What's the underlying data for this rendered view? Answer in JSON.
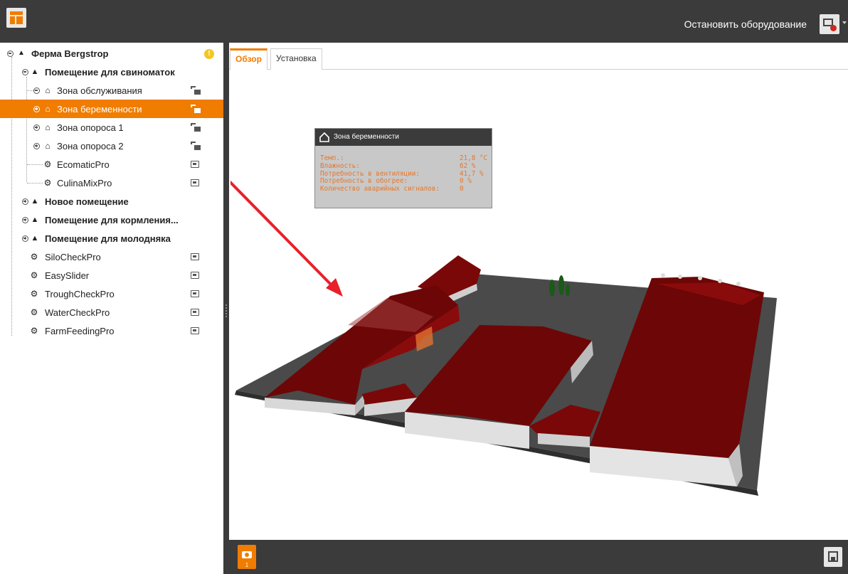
{
  "header": {
    "stop_equipment_label": "Остановить оборудование",
    "logo_icon": "app-logo-icon",
    "equipment_icon": "equipment-status-icon"
  },
  "tree": {
    "farm": {
      "label": "Ферма Bergstrop",
      "alert": "!"
    },
    "rooms": [
      {
        "label": "Помещение для свиноматок"
      },
      {
        "label": "Новое помещение"
      },
      {
        "label": "Помещение для кормления..."
      },
      {
        "label": "Помещение для молодняка"
      }
    ],
    "zones": [
      {
        "label": "Зона обслуживания"
      },
      {
        "label": "Зона беременности"
      },
      {
        "label": "Зона опороса 1"
      },
      {
        "label": "Зона опороса 2"
      }
    ],
    "room_devices": [
      {
        "label": "EcomaticPro"
      },
      {
        "label": "CulinaMixPro"
      }
    ],
    "farm_devices": [
      {
        "label": "SiloCheckPro"
      },
      {
        "label": "EasySlider"
      },
      {
        "label": "TroughCheckPro"
      },
      {
        "label": "WaterCheckPro"
      },
      {
        "label": "FarmFeedingPro"
      }
    ]
  },
  "tabs": [
    {
      "label": "Обзор",
      "active": true
    },
    {
      "label": "Установка",
      "active": false
    }
  ],
  "info_panel": {
    "title": "Зона беременности",
    "rows": [
      {
        "key": "Темп.:",
        "value": "21,8 °C"
      },
      {
        "key": "Влажность:",
        "value": "62 %"
      },
      {
        "key": "Потребность в вентиляции:",
        "value": "41,7 %"
      },
      {
        "key": "Потребность в обогрее:",
        "value": "0 %"
      },
      {
        "key": "Количество аварийных сигналов:",
        "value": "0"
      }
    ]
  },
  "bottom": {
    "camera_badge": "1"
  },
  "colors": {
    "accent": "#f07c00",
    "bar": "#3b3b3b",
    "roof": "#7a0808",
    "arrow": "#e8202a"
  }
}
